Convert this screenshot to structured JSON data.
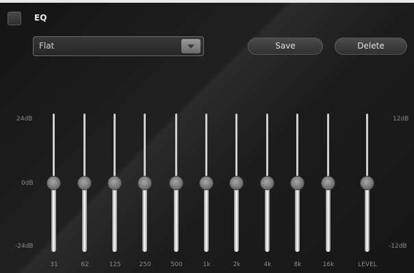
{
  "header": {
    "eq_label": "EQ",
    "eq_enabled": false
  },
  "preset": {
    "selected": "Flat"
  },
  "buttons": {
    "save": "Save",
    "delete": "Delete"
  },
  "scale": {
    "left_top": "24dB",
    "left_mid": "0dB",
    "left_bottom": "-24dB",
    "right_top": "12dB",
    "right_bottom": "-12dB"
  },
  "bands": [
    {
      "label": "31",
      "value_db": 0
    },
    {
      "label": "62",
      "value_db": 0
    },
    {
      "label": "125",
      "value_db": 0
    },
    {
      "label": "250",
      "value_db": 0
    },
    {
      "label": "500",
      "value_db": 0
    },
    {
      "label": "1k",
      "value_db": 0
    },
    {
      "label": "2k",
      "value_db": 0
    },
    {
      "label": "4k",
      "value_db": 0
    },
    {
      "label": "8k",
      "value_db": 0
    },
    {
      "label": "16k",
      "value_db": 0
    }
  ],
  "level": {
    "label": "LEVEL",
    "value_db": 0
  },
  "ranges": {
    "band": [
      -24,
      24
    ],
    "level": [
      -12,
      12
    ]
  }
}
